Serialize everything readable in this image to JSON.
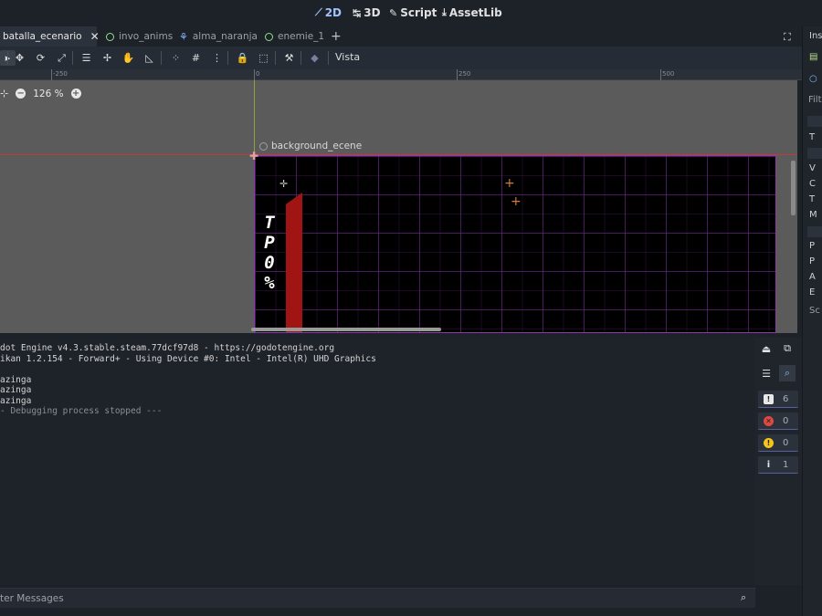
{
  "workspaces": [
    {
      "label": "2D",
      "icon": "2d-icon",
      "active": true
    },
    {
      "label": "3D",
      "icon": "3d-icon",
      "active": false
    },
    {
      "label": "Script",
      "icon": "script-icon",
      "active": false
    },
    {
      "label": "AssetLib",
      "icon": "download-icon",
      "active": false
    }
  ],
  "scene_tabs": [
    {
      "label": "batalla_ecenario",
      "active": true
    },
    {
      "label": "invo_anims",
      "active": false
    },
    {
      "label": "alma_naranja",
      "active": false
    },
    {
      "label": "enemie_1",
      "active": false
    }
  ],
  "add_tab": "+",
  "toolbar": {
    "view_menu": "Vista"
  },
  "ruler": {
    "labels": [
      "-250",
      "0",
      "250",
      "500"
    ]
  },
  "viewport": {
    "zoom_level": "126 %",
    "node_label": "background_ecene",
    "scene_vertical_text": [
      "T",
      "P",
      "0",
      "%"
    ]
  },
  "output": {
    "lines": [
      "dot Engine v4.3.stable.steam.77dcf97d8 - https://godotengine.org",
      "ikan 1.2.154 - Forward+ - Using Device #0: Intel - Intel(R) UHD Graphics",
      "",
      "azinga",
      "azinga",
      "azinga",
      "- Debugging process stopped ---"
    ],
    "counters": [
      {
        "name": "messages",
        "value": "6",
        "color": "#ffffff"
      },
      {
        "name": "errors",
        "value": "0",
        "color": "#e0493f"
      },
      {
        "name": "warnings",
        "value": "0",
        "color": "#f5c518"
      },
      {
        "name": "info",
        "value": "1",
        "color": "#dddddd"
      }
    ],
    "filter_placeholder": "ter Messages"
  },
  "right_dock": {
    "title": "Ins",
    "filter": "Filt",
    "bottom_label": "Sc",
    "rows": [
      "T",
      "V",
      "C",
      "T",
      "M",
      "P",
      "P",
      "A",
      "E"
    ]
  }
}
